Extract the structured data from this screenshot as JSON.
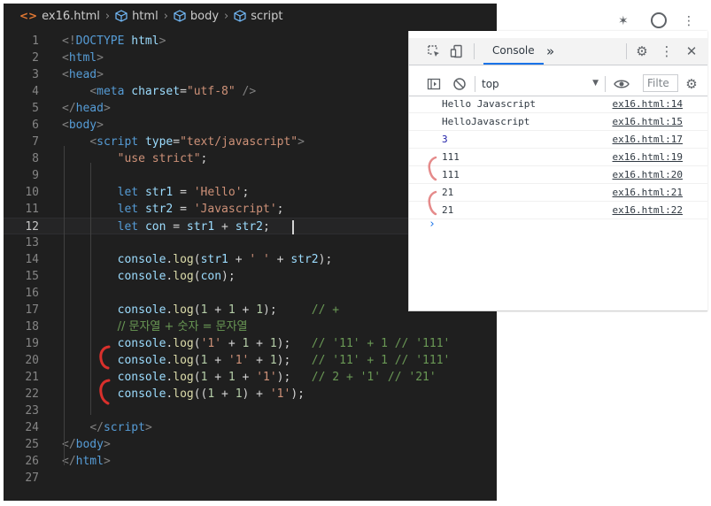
{
  "breadcrumb": {
    "file": "ex16.html",
    "items": [
      "html",
      "body",
      "script"
    ]
  },
  "editor": {
    "current_line": 12,
    "lines": [
      {
        "n": "1",
        "tokens": [
          {
            "t": "<!",
            "c": "punct"
          },
          {
            "t": "DOCTYPE",
            "c": "tag"
          },
          {
            "t": " ",
            "c": "plain"
          },
          {
            "t": "html",
            "c": "attr"
          },
          {
            "t": ">",
            "c": "punct"
          }
        ]
      },
      {
        "n": "2",
        "tokens": [
          {
            "t": "<",
            "c": "punct"
          },
          {
            "t": "html",
            "c": "tag"
          },
          {
            "t": ">",
            "c": "punct"
          }
        ]
      },
      {
        "n": "3",
        "tokens": [
          {
            "t": "<",
            "c": "punct"
          },
          {
            "t": "head",
            "c": "tag"
          },
          {
            "t": ">",
            "c": "punct"
          }
        ]
      },
      {
        "n": "4",
        "tokens": [
          {
            "t": "    ",
            "c": "plain"
          },
          {
            "t": "<",
            "c": "punct"
          },
          {
            "t": "meta",
            "c": "tag"
          },
          {
            "t": " ",
            "c": "plain"
          },
          {
            "t": "charset",
            "c": "attr"
          },
          {
            "t": "=",
            "c": "plain"
          },
          {
            "t": "\"utf-8\"",
            "c": "str"
          },
          {
            "t": " />",
            "c": "punct"
          }
        ]
      },
      {
        "n": "5",
        "tokens": [
          {
            "t": "</",
            "c": "punct"
          },
          {
            "t": "head",
            "c": "tag"
          },
          {
            "t": ">",
            "c": "punct"
          }
        ]
      },
      {
        "n": "6",
        "tokens": [
          {
            "t": "<",
            "c": "punct"
          },
          {
            "t": "body",
            "c": "tag"
          },
          {
            "t": ">",
            "c": "punct"
          }
        ]
      },
      {
        "n": "7",
        "tokens": [
          {
            "t": "    ",
            "c": "plain"
          },
          {
            "t": "<",
            "c": "punct"
          },
          {
            "t": "script",
            "c": "tag"
          },
          {
            "t": " ",
            "c": "plain"
          },
          {
            "t": "type",
            "c": "attr"
          },
          {
            "t": "=",
            "c": "plain"
          },
          {
            "t": "\"text/javascript\"",
            "c": "str"
          },
          {
            "t": ">",
            "c": "punct"
          }
        ]
      },
      {
        "n": "8",
        "tokens": [
          {
            "t": "        ",
            "c": "plain"
          },
          {
            "t": "\"use strict\"",
            "c": "str"
          },
          {
            "t": ";",
            "c": "plain"
          }
        ]
      },
      {
        "n": "9",
        "tokens": []
      },
      {
        "n": "10",
        "tokens": [
          {
            "t": "        ",
            "c": "plain"
          },
          {
            "t": "let",
            "c": "kw"
          },
          {
            "t": " ",
            "c": "plain"
          },
          {
            "t": "str1",
            "c": "var"
          },
          {
            "t": " = ",
            "c": "plain"
          },
          {
            "t": "'Hello'",
            "c": "str"
          },
          {
            "t": ";",
            "c": "plain"
          }
        ]
      },
      {
        "n": "11",
        "tokens": [
          {
            "t": "        ",
            "c": "plain"
          },
          {
            "t": "let",
            "c": "kw"
          },
          {
            "t": " ",
            "c": "plain"
          },
          {
            "t": "str2",
            "c": "var"
          },
          {
            "t": " = ",
            "c": "plain"
          },
          {
            "t": "'Javascript'",
            "c": "str"
          },
          {
            "t": ";",
            "c": "plain"
          }
        ]
      },
      {
        "n": "12",
        "tokens": [
          {
            "t": "        ",
            "c": "plain"
          },
          {
            "t": "let",
            "c": "kw"
          },
          {
            "t": " ",
            "c": "plain"
          },
          {
            "t": "con",
            "c": "var"
          },
          {
            "t": " = ",
            "c": "plain"
          },
          {
            "t": "str1",
            "c": "var"
          },
          {
            "t": " + ",
            "c": "plain"
          },
          {
            "t": "str2",
            "c": "var"
          },
          {
            "t": ";",
            "c": "plain"
          }
        ]
      },
      {
        "n": "13",
        "tokens": []
      },
      {
        "n": "14",
        "tokens": [
          {
            "t": "        ",
            "c": "plain"
          },
          {
            "t": "console",
            "c": "var"
          },
          {
            "t": ".",
            "c": "plain"
          },
          {
            "t": "log",
            "c": "fn"
          },
          {
            "t": "(",
            "c": "plain"
          },
          {
            "t": "str1",
            "c": "var"
          },
          {
            "t": " + ",
            "c": "plain"
          },
          {
            "t": "' '",
            "c": "str"
          },
          {
            "t": " + ",
            "c": "plain"
          },
          {
            "t": "str2",
            "c": "var"
          },
          {
            "t": ");",
            "c": "plain"
          }
        ]
      },
      {
        "n": "15",
        "tokens": [
          {
            "t": "        ",
            "c": "plain"
          },
          {
            "t": "console",
            "c": "var"
          },
          {
            "t": ".",
            "c": "plain"
          },
          {
            "t": "log",
            "c": "fn"
          },
          {
            "t": "(",
            "c": "plain"
          },
          {
            "t": "con",
            "c": "var"
          },
          {
            "t": ");",
            "c": "plain"
          }
        ]
      },
      {
        "n": "16",
        "tokens": []
      },
      {
        "n": "17",
        "tokens": [
          {
            "t": "        ",
            "c": "plain"
          },
          {
            "t": "console",
            "c": "var"
          },
          {
            "t": ".",
            "c": "plain"
          },
          {
            "t": "log",
            "c": "fn"
          },
          {
            "t": "(",
            "c": "plain"
          },
          {
            "t": "1",
            "c": "num"
          },
          {
            "t": " + ",
            "c": "plain"
          },
          {
            "t": "1",
            "c": "num"
          },
          {
            "t": " + ",
            "c": "plain"
          },
          {
            "t": "1",
            "c": "num"
          },
          {
            "t": ");",
            "c": "plain"
          },
          {
            "t": "     // +",
            "c": "com"
          }
        ]
      },
      {
        "n": "18",
        "tokens": [
          {
            "t": "        ",
            "c": "plain"
          },
          {
            "t": "// 문자열 + 숫자 = 문자열",
            "c": "com"
          }
        ]
      },
      {
        "n": "19",
        "tokens": [
          {
            "t": "        ",
            "c": "plain"
          },
          {
            "t": "console",
            "c": "var"
          },
          {
            "t": ".",
            "c": "plain"
          },
          {
            "t": "log",
            "c": "fn"
          },
          {
            "t": "(",
            "c": "plain"
          },
          {
            "t": "'1'",
            "c": "str"
          },
          {
            "t": " + ",
            "c": "plain"
          },
          {
            "t": "1",
            "c": "num"
          },
          {
            "t": " + ",
            "c": "plain"
          },
          {
            "t": "1",
            "c": "num"
          },
          {
            "t": ");",
            "c": "plain"
          },
          {
            "t": "   // '11' + 1 // '111'",
            "c": "com"
          }
        ]
      },
      {
        "n": "20",
        "tokens": [
          {
            "t": "        ",
            "c": "plain"
          },
          {
            "t": "console",
            "c": "var"
          },
          {
            "t": ".",
            "c": "plain"
          },
          {
            "t": "log",
            "c": "fn"
          },
          {
            "t": "(",
            "c": "plain"
          },
          {
            "t": "1",
            "c": "num"
          },
          {
            "t": " + ",
            "c": "plain"
          },
          {
            "t": "'1'",
            "c": "str"
          },
          {
            "t": " + ",
            "c": "plain"
          },
          {
            "t": "1",
            "c": "num"
          },
          {
            "t": ");",
            "c": "plain"
          },
          {
            "t": "   // '11' + 1 // '111'",
            "c": "com"
          }
        ]
      },
      {
        "n": "21",
        "tokens": [
          {
            "t": "        ",
            "c": "plain"
          },
          {
            "t": "console",
            "c": "var"
          },
          {
            "t": ".",
            "c": "plain"
          },
          {
            "t": "log",
            "c": "fn"
          },
          {
            "t": "(",
            "c": "plain"
          },
          {
            "t": "1",
            "c": "num"
          },
          {
            "t": " + ",
            "c": "plain"
          },
          {
            "t": "1",
            "c": "num"
          },
          {
            "t": " + ",
            "c": "plain"
          },
          {
            "t": "'1'",
            "c": "str"
          },
          {
            "t": ");",
            "c": "plain"
          },
          {
            "t": "   // 2 + '1' // '21'",
            "c": "com"
          }
        ]
      },
      {
        "n": "22",
        "tokens": [
          {
            "t": "        ",
            "c": "plain"
          },
          {
            "t": "console",
            "c": "var"
          },
          {
            "t": ".",
            "c": "plain"
          },
          {
            "t": "log",
            "c": "fn"
          },
          {
            "t": "((",
            "c": "plain"
          },
          {
            "t": "1",
            "c": "num"
          },
          {
            "t": " + ",
            "c": "plain"
          },
          {
            "t": "1",
            "c": "num"
          },
          {
            "t": ") + ",
            "c": "plain"
          },
          {
            "t": "'1'",
            "c": "str"
          },
          {
            "t": ");",
            "c": "plain"
          }
        ]
      },
      {
        "n": "23",
        "tokens": []
      },
      {
        "n": "24",
        "tokens": [
          {
            "t": "    ",
            "c": "plain"
          },
          {
            "t": "</",
            "c": "punct"
          },
          {
            "t": "script",
            "c": "tag"
          },
          {
            "t": ">",
            "c": "punct"
          }
        ]
      },
      {
        "n": "25",
        "tokens": [
          {
            "t": "</",
            "c": "punct"
          },
          {
            "t": "body",
            "c": "tag"
          },
          {
            "t": ">",
            "c": "punct"
          }
        ]
      },
      {
        "n": "26",
        "tokens": [
          {
            "t": "</",
            "c": "punct"
          },
          {
            "t": "html",
            "c": "tag"
          },
          {
            "t": ">",
            "c": "punct"
          }
        ]
      },
      {
        "n": "27",
        "tokens": []
      }
    ]
  },
  "devtools": {
    "tab_console": "Console",
    "more_tabs": "»",
    "context": "top",
    "filter_placeholder": "Filte",
    "logs": [
      {
        "message": "Hello Javascript",
        "source": "ex16.html:14",
        "type": "string"
      },
      {
        "message": "HelloJavascript",
        "source": "ex16.html:15",
        "type": "string"
      },
      {
        "message": "3",
        "source": "ex16.html:17",
        "type": "number"
      },
      {
        "message": "111",
        "source": "ex16.html:19",
        "type": "string"
      },
      {
        "message": "111",
        "source": "ex16.html:20",
        "type": "string"
      },
      {
        "message": "21",
        "source": "ex16.html:21",
        "type": "string"
      },
      {
        "message": "21",
        "source": "ex16.html:22",
        "type": "string"
      }
    ],
    "prompt": "›"
  },
  "colors": {
    "editor_bg": "#1f1f1f",
    "annotation_red": "#d9302c",
    "annotation_pink": "#e58a8a",
    "console_number": "#1a1aa6",
    "active_tab": "#1a73e8"
  }
}
